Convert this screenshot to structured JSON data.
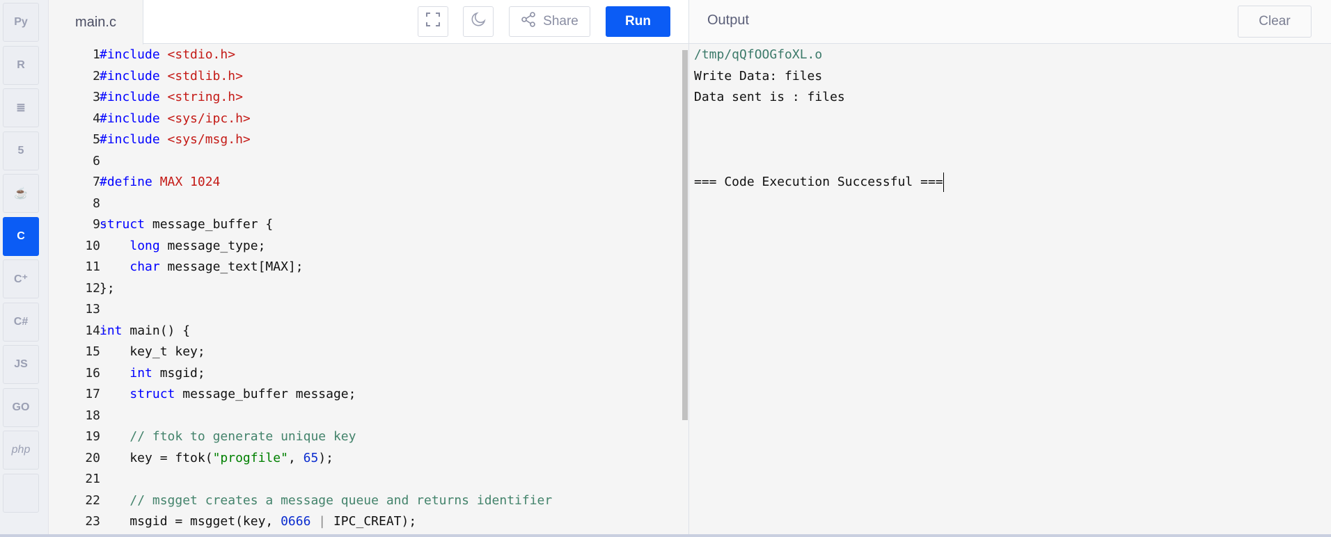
{
  "sidebar": {
    "items": [
      {
        "name": "python",
        "label": "Py"
      },
      {
        "name": "r",
        "label": "R"
      },
      {
        "name": "sql",
        "label": "≣"
      },
      {
        "name": "html",
        "label": "5"
      },
      {
        "name": "java",
        "label": "☕"
      },
      {
        "name": "c",
        "label": "C",
        "active": true
      },
      {
        "name": "cpp",
        "label": "C⁺"
      },
      {
        "name": "csharp",
        "label": "C#"
      },
      {
        "name": "javascript",
        "label": "JS"
      },
      {
        "name": "go",
        "label": "GO"
      },
      {
        "name": "php",
        "label": "php"
      },
      {
        "name": "more",
        "label": ""
      }
    ]
  },
  "editor": {
    "tab": "main.c",
    "share_label": "Share",
    "run_label": "Run",
    "lines": [
      [
        [
          "kw",
          "#include"
        ],
        [
          "",
          ""
        ],
        [
          "inc",
          " <stdio.h>"
        ]
      ],
      [
        [
          "kw",
          "#include"
        ],
        [
          "inc",
          " <stdlib.h>"
        ]
      ],
      [
        [
          "kw",
          "#include"
        ],
        [
          "inc",
          " <string.h>"
        ]
      ],
      [
        [
          "kw",
          "#include"
        ],
        [
          "inc",
          " <sys/ipc.h>"
        ]
      ],
      [
        [
          "kw",
          "#include"
        ],
        [
          "inc",
          " <sys/msg.h>"
        ]
      ],
      [],
      [
        [
          "kw",
          "#define"
        ],
        [
          "inc",
          " MAX 1024"
        ]
      ],
      [],
      [
        [
          "kw",
          "struct"
        ],
        [
          "",
          " message_buffer {"
        ]
      ],
      [
        [
          "",
          "    "
        ],
        [
          "kw",
          "long"
        ],
        [
          "",
          " message_type;"
        ]
      ],
      [
        [
          "",
          "    "
        ],
        [
          "kw",
          "char"
        ],
        [
          "",
          " message_text[MAX];"
        ]
      ],
      [
        [
          "",
          "};"
        ]
      ],
      [],
      [
        [
          "kw",
          "int"
        ],
        [
          "",
          " main() {"
        ]
      ],
      [
        [
          "",
          "    key_t key;"
        ]
      ],
      [
        [
          "",
          "    "
        ],
        [
          "kw",
          "int"
        ],
        [
          "",
          " msgid;"
        ]
      ],
      [
        [
          "",
          "    "
        ],
        [
          "kw",
          "struct"
        ],
        [
          "",
          " message_buffer message;"
        ]
      ],
      [],
      [
        [
          "",
          "    "
        ],
        [
          "com",
          "// ftok to generate unique key"
        ]
      ],
      [
        [
          "",
          "    key = ftok("
        ],
        [
          "str",
          "\"progfile\""
        ],
        [
          "",
          ", "
        ],
        [
          "num",
          "65"
        ],
        [
          "",
          ");"
        ]
      ],
      [],
      [
        [
          "",
          "    "
        ],
        [
          "com",
          "// msgget creates a message queue and returns identifier"
        ]
      ],
      [
        [
          "",
          "    msgid = msgget(key, "
        ],
        [
          "num",
          "0666"
        ],
        [
          "op",
          " | "
        ],
        [
          "",
          "IPC_CREAT);"
        ]
      ],
      []
    ],
    "folds": [
      9,
      14
    ]
  },
  "output": {
    "title": "Output",
    "clear_label": "Clear",
    "path": "/tmp/qQfOOGfoXL.o",
    "lines": [
      "Write Data: files",
      "Data sent is : files",
      "",
      "",
      "",
      "=== Code Execution Successful ==="
    ]
  }
}
